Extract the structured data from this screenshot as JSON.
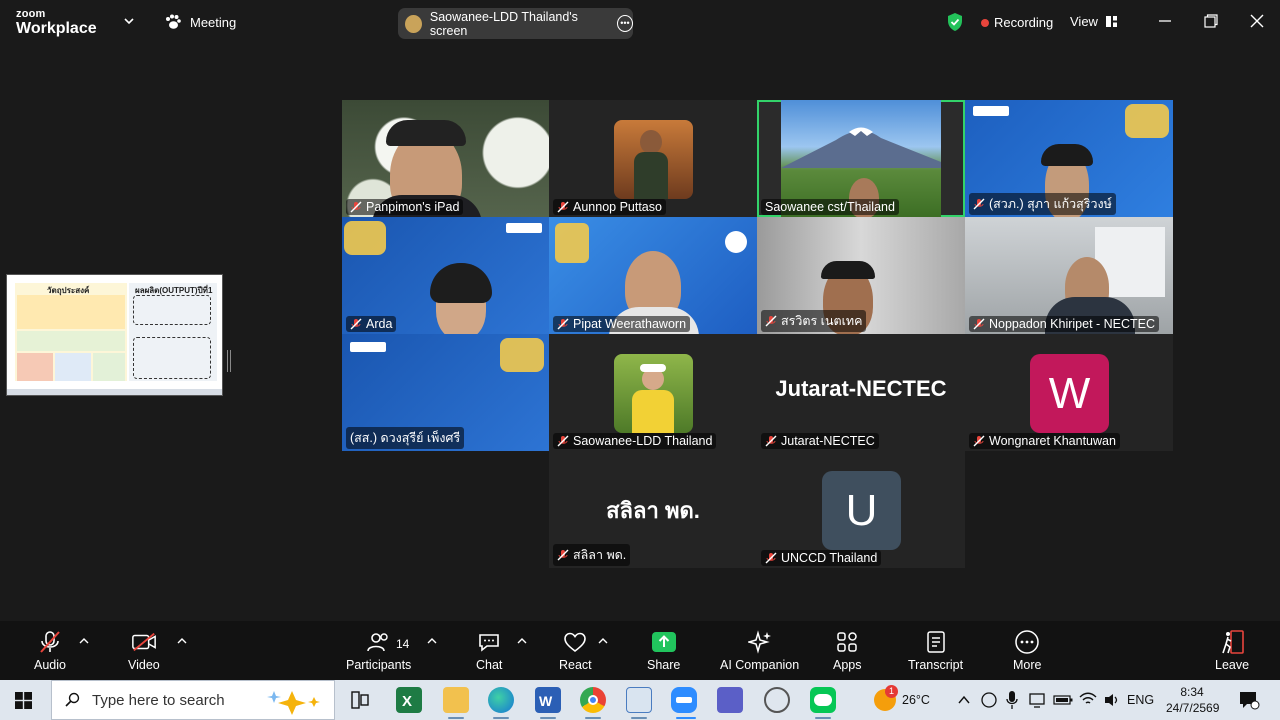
{
  "topbar": {
    "brand_top": "zoom",
    "brand_bottom": "Workplace",
    "meeting_label": "Meeting",
    "share_label": "Saowanee-LDD Thailand's screen",
    "recording_label": "Recording",
    "view_label": "View"
  },
  "tiles": [
    {
      "name": "Panpimon's iPad",
      "muted": true
    },
    {
      "name": "Aunnop Puttaso",
      "muted": true
    },
    {
      "name": "Saowanee cst/Thailand",
      "muted": false,
      "active": true
    },
    {
      "name": "(สวภ.) สุภา แก้วสุริวงษ์",
      "muted": true
    },
    {
      "name": "Arda",
      "muted": true
    },
    {
      "name": "Pipat Weerathaworn",
      "muted": true
    },
    {
      "name": "สรวิตร เนตเทค",
      "muted": true
    },
    {
      "name": "Noppadon Khiripet - NECTEC",
      "muted": true
    },
    {
      "name": "(สส.) ดวงสุรีย์ เพ็งศรี",
      "muted": false
    },
    {
      "name": "Saowanee-LDD Thailand",
      "muted": true
    },
    {
      "name": "Jutarat-NECTEC",
      "muted": true,
      "display": "Jutarat-NECTEC"
    },
    {
      "name": "Wongnaret Khantuwan",
      "muted": true,
      "avatar_letter": "W",
      "avatar_color": "#c2185b"
    },
    {
      "name": "สลิลา พด.",
      "muted": true,
      "display": "สลิลา พด."
    },
    {
      "name": "UNCCD Thailand",
      "muted": true,
      "avatar_letter": "U",
      "avatar_color": "#3f4f5e"
    }
  ],
  "thumbnail": {
    "heading_left": "วัตถุประสงค์",
    "heading_right": "ผลผลิต(OUTPUT)ปีที่1"
  },
  "toolbar": {
    "audio": "Audio",
    "video": "Video",
    "participants": "Participants",
    "participants_count": "14",
    "chat": "Chat",
    "react": "React",
    "share": "Share",
    "ai_companion": "AI Companion",
    "apps": "Apps",
    "transcript": "Transcript",
    "more": "More",
    "leave": "Leave"
  },
  "taskbar": {
    "search_placeholder": "Type here to search",
    "weather_temp": "26°C",
    "weather_badge": "1",
    "language": "ENG",
    "time": "8:34",
    "date": "24/7/2569"
  },
  "colors": {
    "active_speaker": "#33d36a",
    "recording": "#e8453c",
    "share_green": "#21c45d",
    "leave_red": "#e8453c"
  }
}
